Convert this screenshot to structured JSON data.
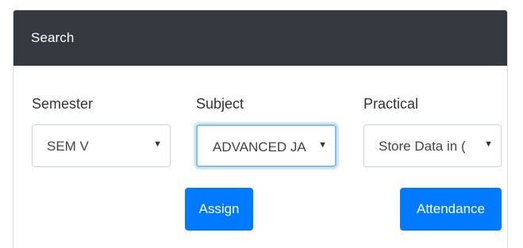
{
  "card": {
    "title": "Search"
  },
  "semester": {
    "label": "Semester",
    "selected": "SEM V",
    "caret_icon": "caret-down-icon"
  },
  "subject": {
    "label": "Subject",
    "selected": "ADVANCED JA",
    "caret_icon": "caret-down-icon"
  },
  "practical": {
    "label": "Practical",
    "selected": "Store Data in (",
    "caret_icon": "caret-down-icon"
  },
  "actions": {
    "assign_label": "Assign",
    "attendance_label": "Attendance"
  },
  "colors": {
    "header_bg": "#343a40",
    "primary": "#007bff",
    "focus": "#80bdff"
  }
}
